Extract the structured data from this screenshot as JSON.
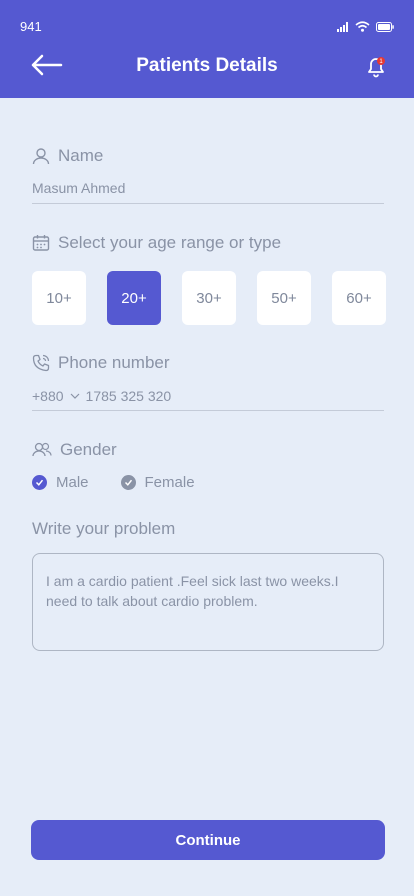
{
  "status_bar": {
    "time": "941",
    "icons": [
      "signal-icon",
      "wifi-icon",
      "battery-icon"
    ]
  },
  "header": {
    "title": "Patients Details",
    "notification_count": "1"
  },
  "name": {
    "label": "Name",
    "value": "Masum Ahmed"
  },
  "age": {
    "label": "Select your age range or type",
    "options": [
      "10+",
      "20+",
      "30+",
      "50+",
      "60+"
    ],
    "selected": "20+"
  },
  "phone": {
    "label": "Phone number",
    "country_code": "+880",
    "number": "1785 325 320"
  },
  "gender": {
    "label": "Gender",
    "options": [
      {
        "label": "Male",
        "checked": true
      },
      {
        "label": "Female",
        "checked": false
      }
    ]
  },
  "problem": {
    "label": "Write your problem",
    "value": "I am a cardio patient .Feel sick last two weeks.I need to talk about cardio problem."
  },
  "continue_label": "Continue",
  "colors": {
    "primary": "#5559d1",
    "background": "#e6edf8",
    "text": "#8a93a6",
    "badge": "#e53935"
  }
}
